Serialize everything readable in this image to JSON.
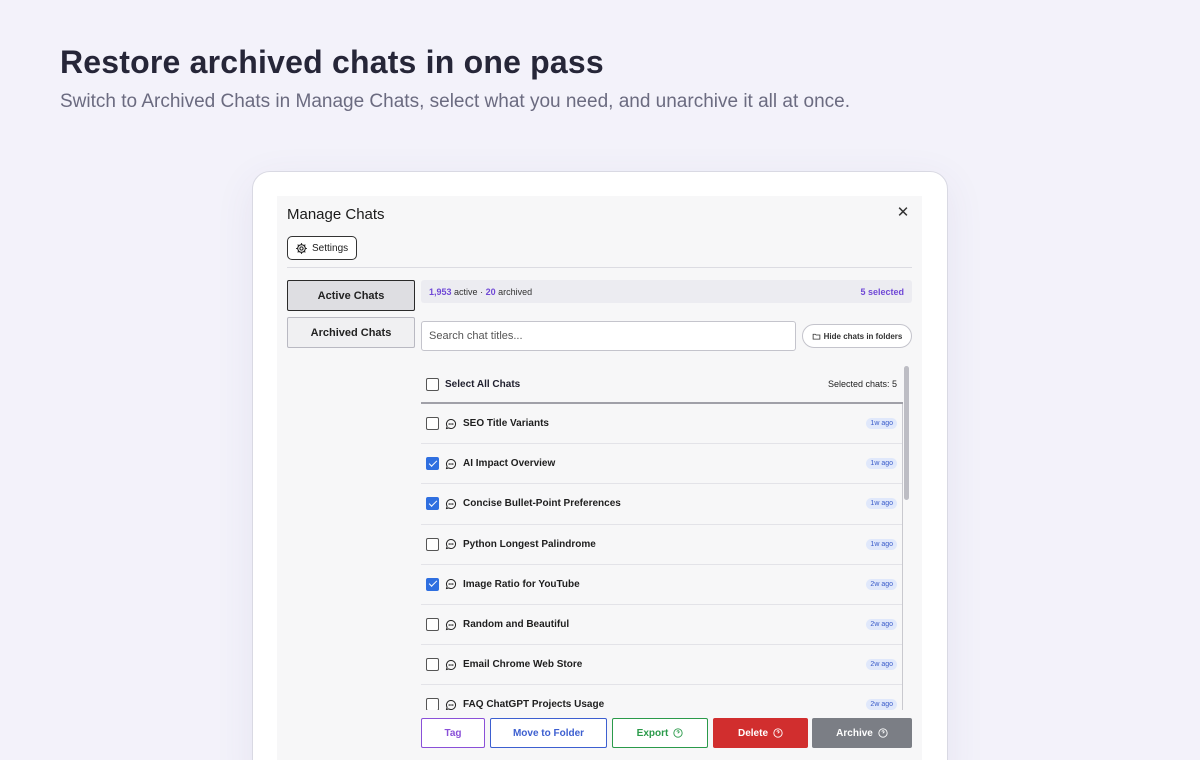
{
  "hero": {
    "title": "Restore archived chats in one pass",
    "subtitle": "Switch to Archived Chats in Manage Chats, select what you need, and unarchive it all at once."
  },
  "modal": {
    "title": "Manage Chats",
    "close_icon": "close-icon",
    "settings_label": "Settings"
  },
  "tabs": {
    "active_label": "Active Chats",
    "archived_label": "Archived Chats"
  },
  "status": {
    "active_count": "1,953",
    "active_word": "active",
    "separator": "·",
    "archived_count": "20",
    "archived_word": "archived",
    "selected_text": "5 selected"
  },
  "search": {
    "placeholder": "Search chat titles...",
    "value": ""
  },
  "hide_folders_label": "Hide chats in folders",
  "list": {
    "select_all_label": "Select All Chats",
    "selected_count_text": "Selected chats: 5",
    "rows": [
      {
        "title": "SEO Title Variants",
        "age": "1w ago",
        "checked": false
      },
      {
        "title": "AI Impact Overview",
        "age": "1w ago",
        "checked": true
      },
      {
        "title": "Concise Bullet-Point Preferences",
        "age": "1w ago",
        "checked": true
      },
      {
        "title": "Python Longest Palindrome",
        "age": "1w ago",
        "checked": false
      },
      {
        "title": "Image Ratio for YouTube",
        "age": "2w ago",
        "checked": true
      },
      {
        "title": "Random and Beautiful",
        "age": "2w ago",
        "checked": false
      },
      {
        "title": "Email Chrome Web Store",
        "age": "2w ago",
        "checked": false
      },
      {
        "title": "FAQ ChatGPT Projects Usage",
        "age": "2w ago",
        "checked": false
      }
    ]
  },
  "actions": {
    "tag": "Tag",
    "move": "Move to Folder",
    "export": "Export",
    "delete": "Delete",
    "archive": "Archive"
  },
  "colors": {
    "accent_purple": "#7048d6",
    "check_blue": "#2f6fe0",
    "delete_red": "#d12e2e",
    "export_green": "#2a9a4a"
  }
}
